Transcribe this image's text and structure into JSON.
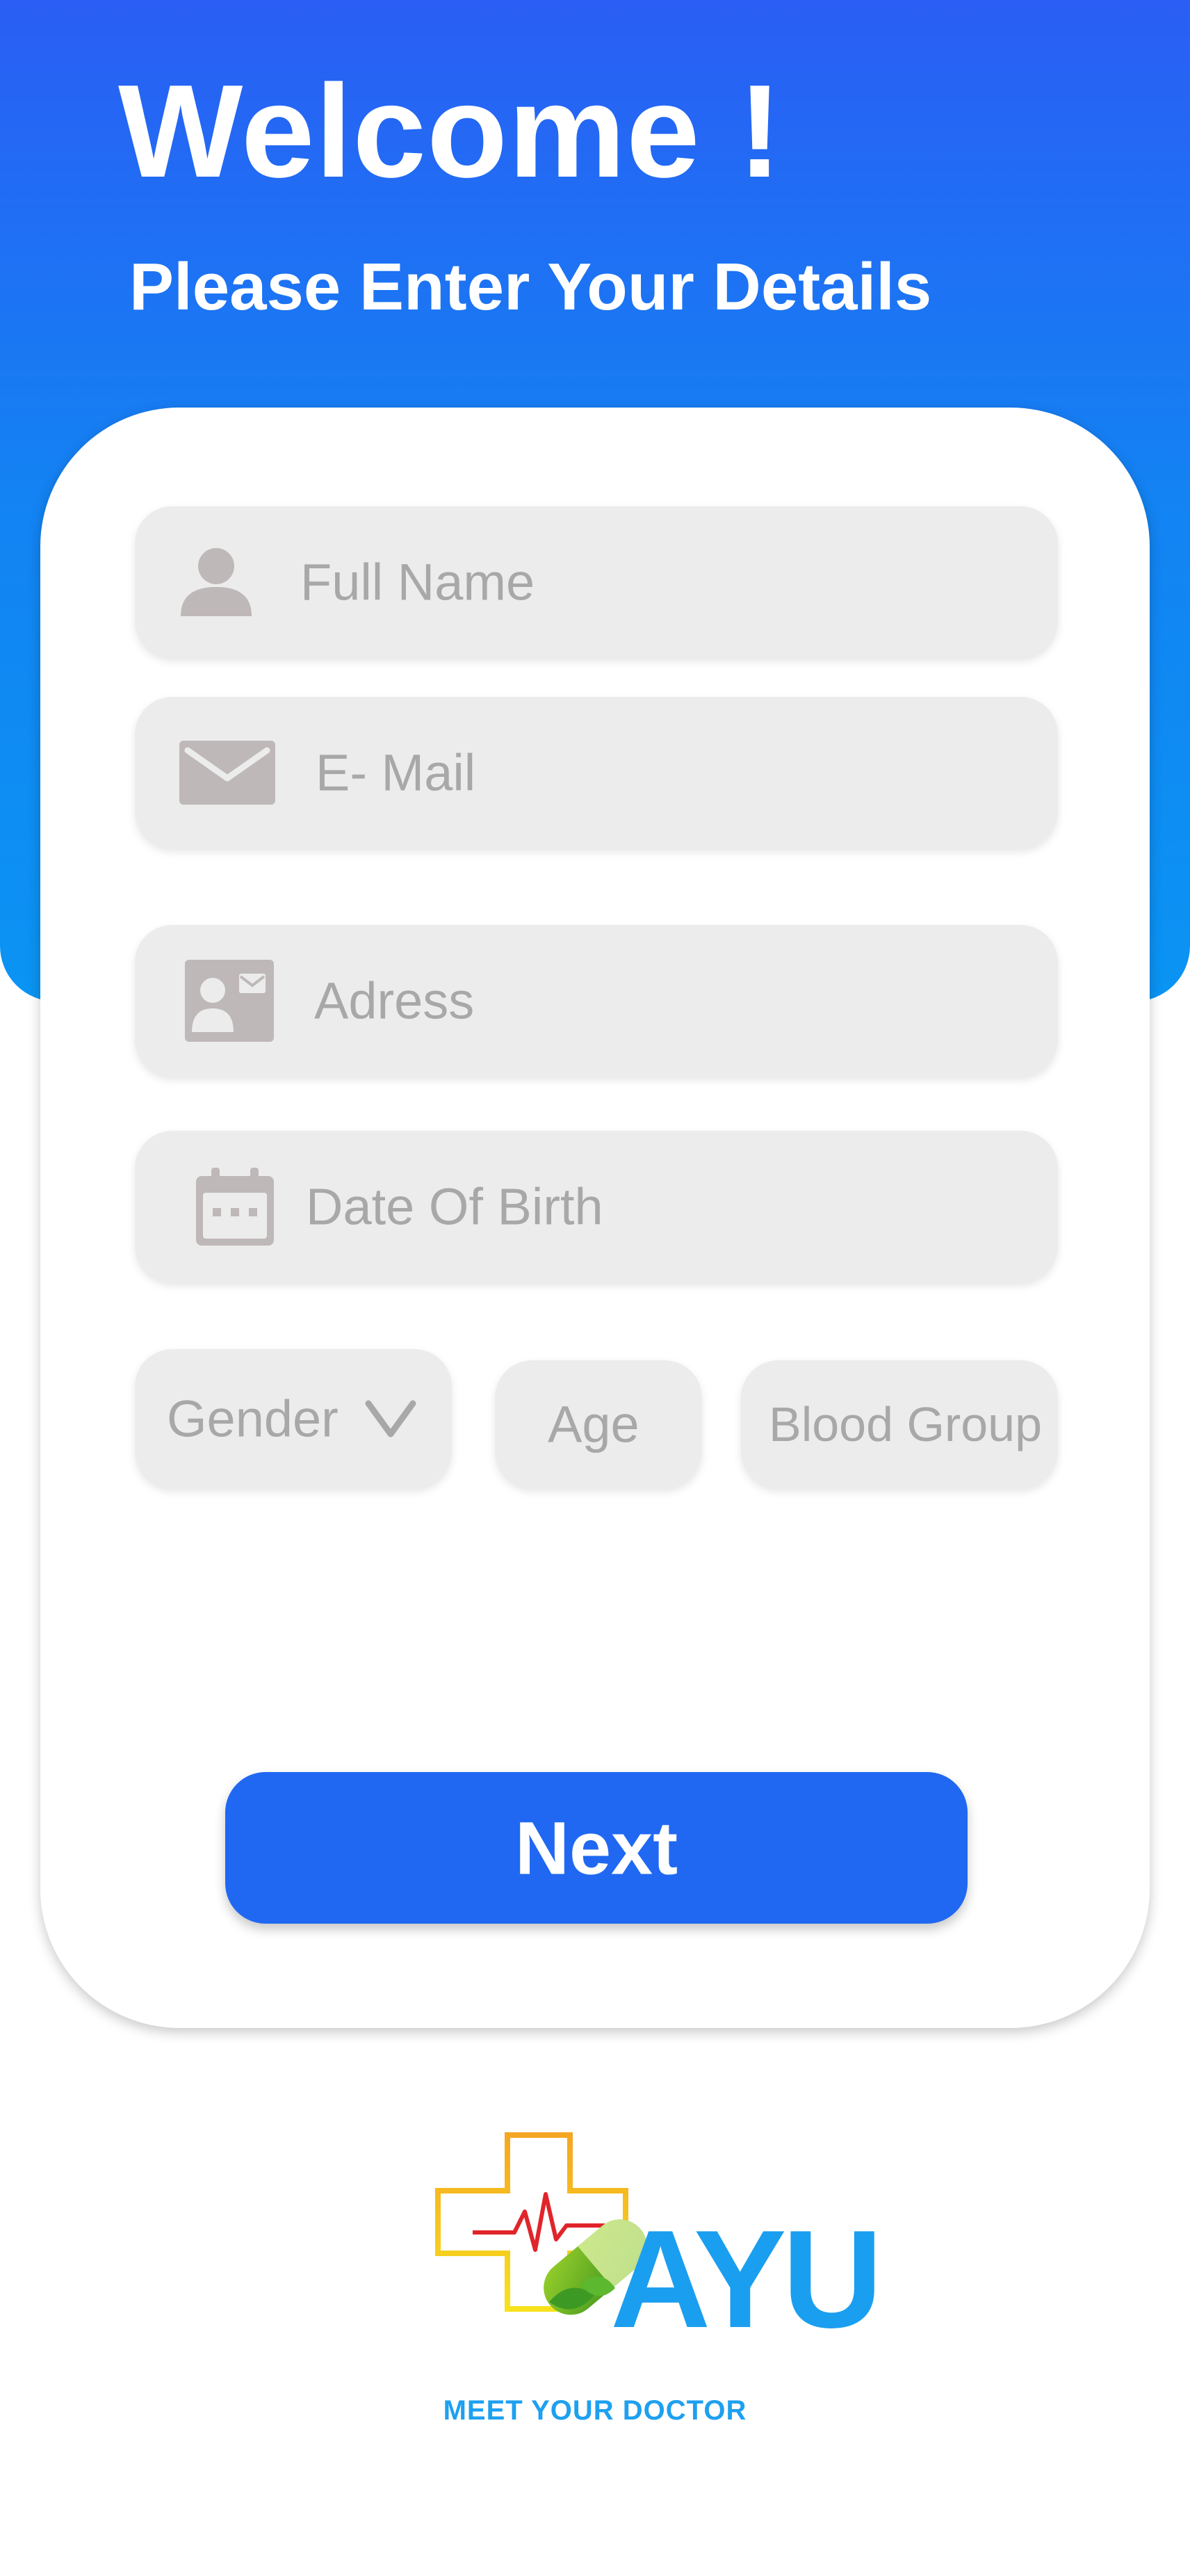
{
  "header": {
    "title": "Welcome !",
    "subtitle": "Please Enter Your Details"
  },
  "form": {
    "full_name_placeholder": "Full Name",
    "email_placeholder": "E- Mail",
    "address_placeholder": "Adress",
    "dob_placeholder": "Date Of Birth",
    "gender_placeholder": "Gender",
    "age_placeholder": "Age",
    "blood_group_placeholder": "Blood Group",
    "next_label": "Next"
  },
  "brand": {
    "logo_letters": "AYU",
    "tagline": "MEET YOUR DOCTOR"
  },
  "icons": {
    "full_name": "person-icon",
    "email": "envelope-icon",
    "address": "contact-card-icon",
    "dob": "calendar-icon",
    "gender_dropdown": "chevron-down-icon"
  },
  "colors": {
    "header_gradient_top": "#2a5ef4",
    "header_gradient_bottom": "#0a94f3",
    "accent_button": "#2068f2",
    "field_bg": "#ececec",
    "placeholder_text": "#a8a8a8",
    "icon": "#bfb8b8",
    "tagline": "#1ea0f0"
  }
}
